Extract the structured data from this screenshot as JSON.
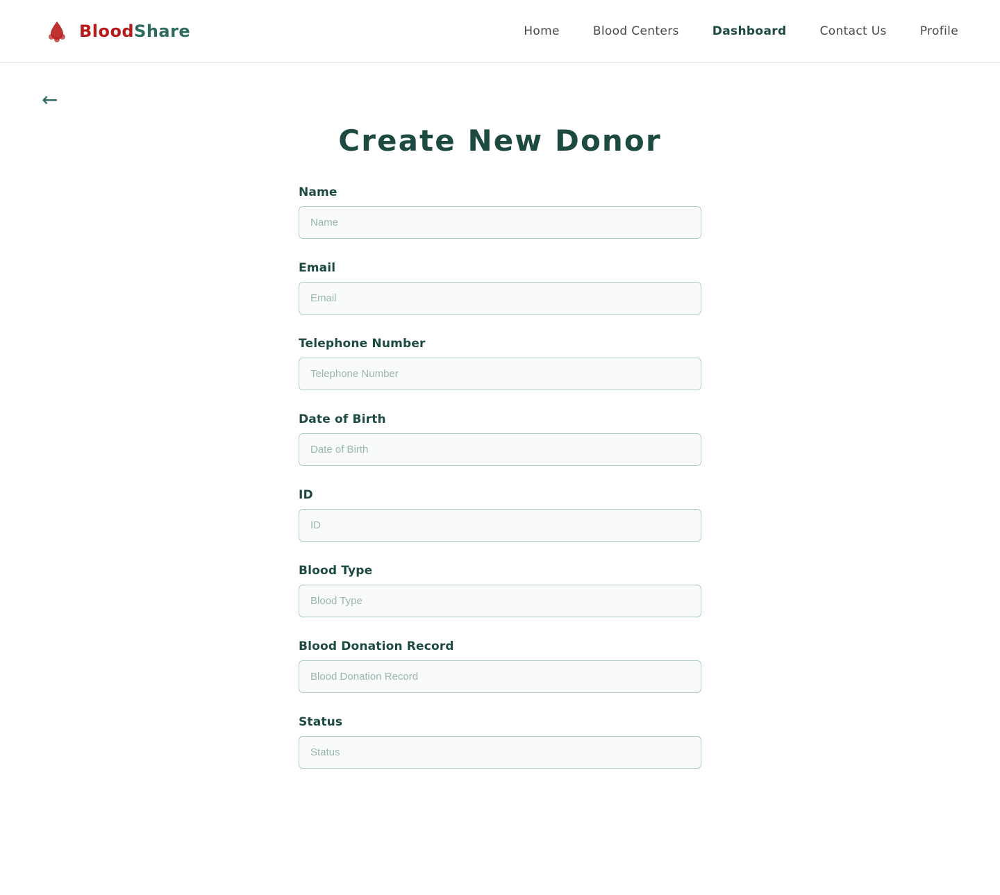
{
  "nav": {
    "logo_blood": "Blood",
    "logo_share": "Share",
    "links": [
      {
        "label": "Home",
        "active": false
      },
      {
        "label": "Blood Centers",
        "active": false
      },
      {
        "label": "Dashboard",
        "active": true
      },
      {
        "label": "Contact Us",
        "active": false
      },
      {
        "label": "Profile",
        "active": false
      }
    ]
  },
  "page": {
    "title": "Create New Donor",
    "back_label": "←"
  },
  "form": {
    "fields": [
      {
        "id": "name",
        "label": "Name",
        "placeholder": "Name"
      },
      {
        "id": "email",
        "label": "Email",
        "placeholder": "Email"
      },
      {
        "id": "telephone",
        "label": "Telephone Number",
        "placeholder": "Telephone Number"
      },
      {
        "id": "dob",
        "label": "Date of Birth",
        "placeholder": "Date of Birth"
      },
      {
        "id": "id",
        "label": "ID",
        "placeholder": "ID"
      },
      {
        "id": "blood_type",
        "label": "Blood Type",
        "placeholder": "Blood Type"
      },
      {
        "id": "blood_donation_record",
        "label": "Blood Donation Record",
        "placeholder": "Blood Donation Record"
      },
      {
        "id": "status",
        "label": "Status",
        "placeholder": "Status"
      }
    ]
  }
}
